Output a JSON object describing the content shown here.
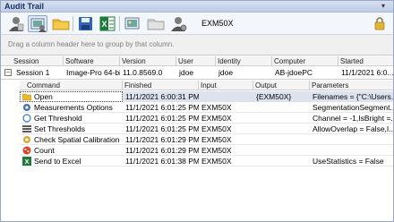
{
  "window": {
    "title": "Audit Trail"
  },
  "toolbar": {
    "session_label": "EXM50X",
    "buttons": [
      {
        "icon": "user-icon"
      },
      {
        "icon": "image-session-icon"
      },
      {
        "icon": "folder-open-icon"
      },
      {
        "icon": "save-disk-icon"
      },
      {
        "icon": "excel-export-icon"
      },
      {
        "icon": "image-view-icon"
      },
      {
        "icon": "folder-icon"
      },
      {
        "icon": "user-settings-icon"
      }
    ],
    "lock_icon": "lock-icon"
  },
  "groupbar": {
    "hint": "Drag a column header here to group by that column."
  },
  "sessions_table": {
    "headers": {
      "session": "Session",
      "software": "Software",
      "version": "Version",
      "user": "User",
      "identity": "Identity",
      "computer": "Computer",
      "started": "Started"
    },
    "rows": [
      {
        "expander": "–",
        "session": "Session 1",
        "software": "Image-Pro 64-bit",
        "version": "11.0.8569.0",
        "user": "jdoe",
        "identity": "jdoe",
        "computer": "AB-jdoePC",
        "started": "11/1/2021 6:0..."
      }
    ]
  },
  "commands_table": {
    "headers": {
      "command": "Command",
      "finished": "Finished",
      "input": "Input",
      "output": "Output",
      "parameters": "Parameters"
    },
    "rows": [
      {
        "icon": "folder-open-icon",
        "command": "Open",
        "finished": "11/1/2021 6:00:31 PM",
        "input": "",
        "output": "{EXM50X}",
        "parameters": "Filenames = {\"C:\\Users..."
      },
      {
        "icon": "gear-icon",
        "command": "Measurements Options",
        "finished": "11/1/2021 6:01:25 PM",
        "input": "EXM50X",
        "output": "",
        "parameters": "SegmentationSegment..."
      },
      {
        "icon": "circle-threshold-icon",
        "command": "Get Threshold",
        "finished": "11/1/2021 6:01:25 PM",
        "input": "EXM50X",
        "output": "",
        "parameters": "Channel = -1,IsBright =..."
      },
      {
        "icon": "list-icon",
        "command": "Set Thresholds",
        "finished": "11/1/2021 6:01:25 PM",
        "input": "EXM50X",
        "output": "",
        "parameters": "AllowOverlap = False,I..."
      },
      {
        "icon": "calibration-gear-icon",
        "command": "Check Spatial Calibration",
        "finished": "11/1/2021 6:01:29 PM",
        "input": "EXM50X",
        "output": "",
        "parameters": ""
      },
      {
        "icon": "count-icon",
        "command": "Count",
        "finished": "11/1/2021 6:01:29 PM",
        "input": "EXM50X",
        "output": "",
        "parameters": ""
      },
      {
        "icon": "send-to-excel-icon",
        "command": "Send to Excel",
        "finished": "11/1/2021 6:01:38 PM",
        "input": "EXM50X",
        "output": "",
        "parameters": "UseStatistics = False"
      }
    ]
  },
  "colors": {
    "title_gradient_top": "#d5dff0",
    "selection": "#dde3ee",
    "folder": "#e8b830",
    "excel": "#1e7a3a"
  }
}
